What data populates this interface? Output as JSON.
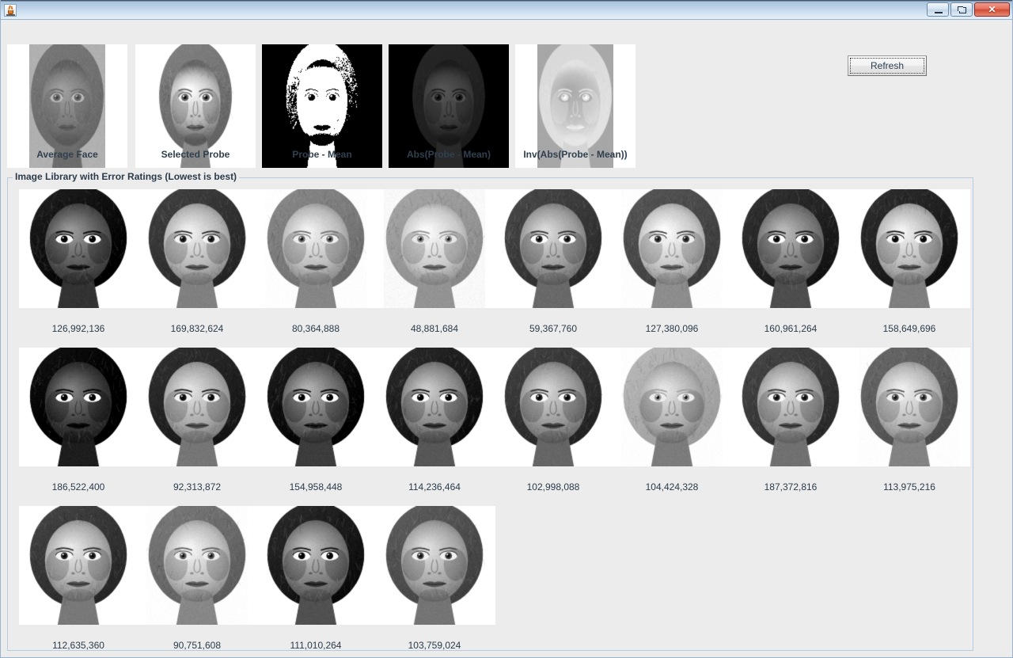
{
  "window": {
    "title": "",
    "icon": "java-coffee-cup-icon",
    "controls": {
      "minimize_label": "",
      "maximize_label": "",
      "close_label": "✕"
    }
  },
  "toolbar": {
    "refresh_label": "Refresh"
  },
  "analysis_panels": [
    {
      "label": "Average Face",
      "name": "average-face"
    },
    {
      "label": "Selected Probe",
      "name": "selected-probe"
    },
    {
      "label": "Probe - Mean",
      "name": "probe-minus-mean"
    },
    {
      "label": "Abs(Probe - Mean)",
      "name": "abs-probe-minus-mean"
    },
    {
      "label": "Inv(Abs(Probe - Mean))",
      "name": "inv-abs-probe-minus-mean"
    }
  ],
  "library": {
    "title": "Image Library with Error Ratings (Lowest is best)",
    "rows": [
      {
        "items": [
          {
            "error": "126,992,136"
          },
          {
            "error": "169,832,624"
          },
          {
            "error": "80,364,888"
          },
          {
            "error": "48,881,684"
          },
          {
            "error": "59,367,760"
          },
          {
            "error": "127,380,096"
          },
          {
            "error": "160,961,264"
          },
          {
            "error": "158,649,696"
          }
        ]
      },
      {
        "items": [
          {
            "error": "186,522,400"
          },
          {
            "error": "92,313,872"
          },
          {
            "error": "154,958,448"
          },
          {
            "error": "114,236,464"
          },
          {
            "error": "102,998,088"
          },
          {
            "error": "104,424,328"
          },
          {
            "error": "187,372,816"
          },
          {
            "error": "113,975,216"
          }
        ]
      },
      {
        "items": [
          {
            "error": "112,635,360"
          },
          {
            "error": "90,751,608"
          },
          {
            "error": "111,010,264"
          },
          {
            "error": "103,759,024"
          }
        ]
      }
    ]
  },
  "colors": {
    "window_background": "#ececed",
    "panel_border": "#b6cbe0",
    "title_text": "#2b3b4a",
    "titlebar_gradient_top": "#44566b",
    "titlebar_gradient_mid": "#b9d0e6",
    "titlebar_gradient_bottom": "#e8f1fa",
    "close_button": "#cf4a33",
    "cell_background": "#ffffff"
  }
}
